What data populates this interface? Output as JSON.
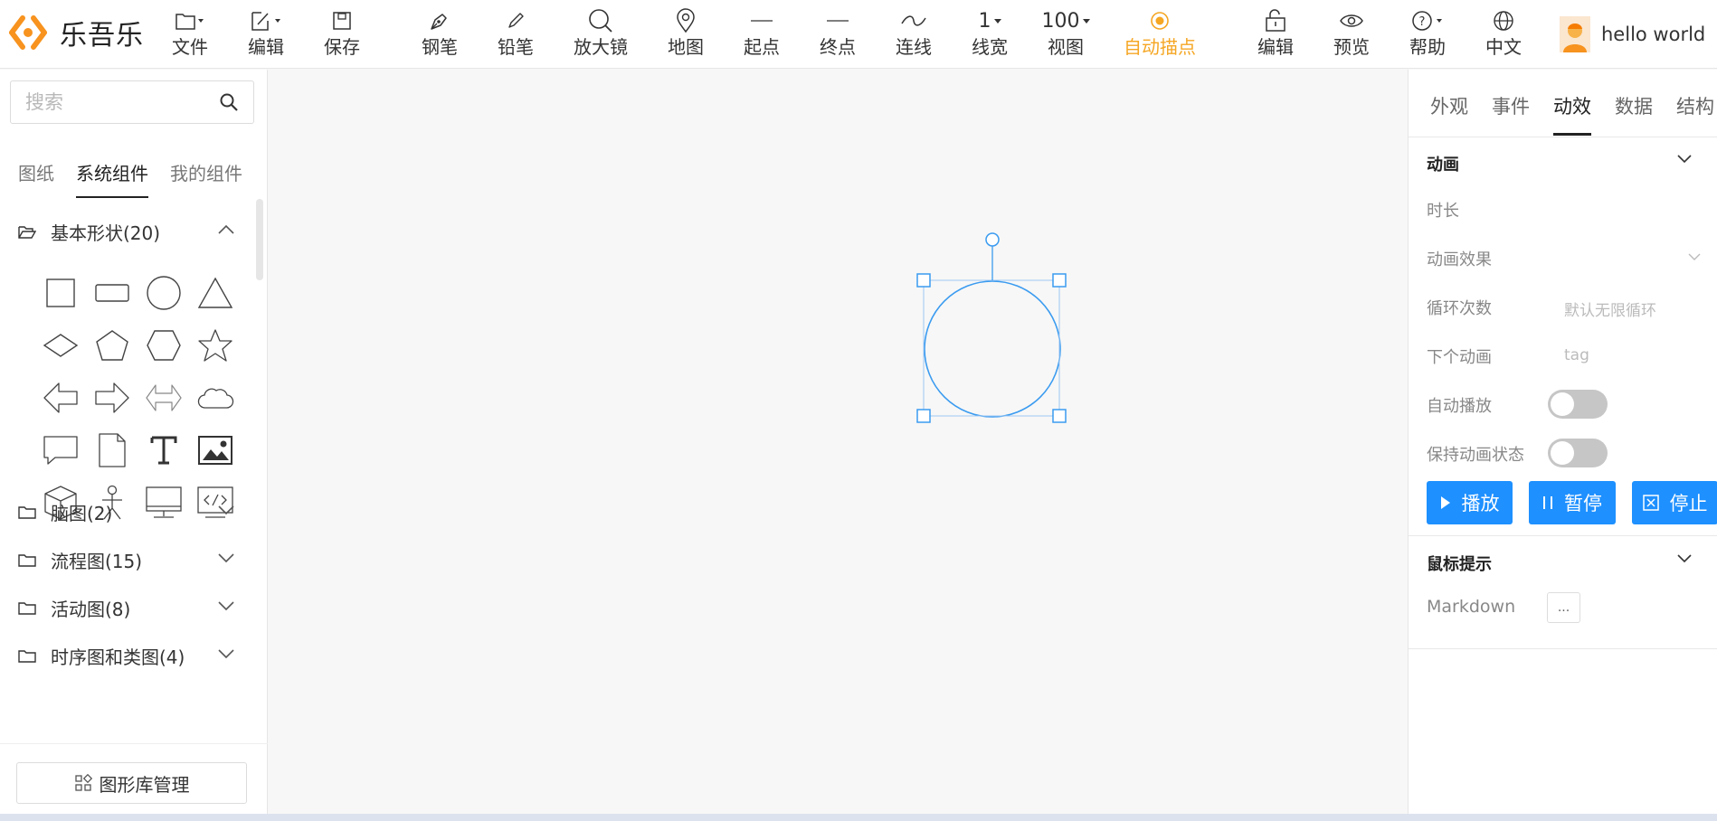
{
  "app": {
    "name": "乐吾乐"
  },
  "toolbar": {
    "file": "文件",
    "edit": "编辑",
    "save": "保存",
    "pen": "钢笔",
    "pencil": "铅笔",
    "magnifier": "放大镜",
    "map": "地图",
    "start_point": "起点",
    "end_point": "终点",
    "connect": "连线",
    "line_width_value": "1",
    "line_width": "线宽",
    "view_value": "100",
    "view": "视图",
    "auto_anchor": "自动描点",
    "edit2": "编辑",
    "preview": "预览",
    "help": "帮助",
    "language": "中文"
  },
  "user": {
    "name": "hello world"
  },
  "left_panel": {
    "search_placeholder": "搜索",
    "tabs": [
      "图纸",
      "系统组件",
      "我的组件"
    ],
    "active_tab": "系统组件",
    "groups": [
      {
        "name": "基本形状(20)",
        "expanded": true
      },
      {
        "name": "脑图(2)",
        "expanded": false
      },
      {
        "name": "流程图(15)",
        "expanded": false
      },
      {
        "name": "活动图(8)",
        "expanded": false
      },
      {
        "name": "时序图和类图(4)",
        "expanded": false
      }
    ],
    "shapes": [
      "square",
      "rectangle",
      "circle",
      "triangle",
      "diamond",
      "pentagon",
      "hexagon",
      "star",
      "left-arrow",
      "right-arrow",
      "two-way-arrow",
      "cloud",
      "message",
      "file",
      "text",
      "image",
      "cube",
      "people",
      "computer",
      "code"
    ],
    "library_button": "图形库管理"
  },
  "right_panel": {
    "tabs": [
      "外观",
      "事件",
      "动效",
      "数据",
      "结构"
    ],
    "active_tab": "动效",
    "animation": {
      "title": "动画",
      "duration_label": "时长",
      "effect_label": "动画效果",
      "loop_label": "循环次数",
      "loop_placeholder": "默认无限循环",
      "next_label": "下个动画",
      "next_placeholder": "tag",
      "autoplay_label": "自动播放",
      "autoplay": false,
      "keep_label": "保持动画状态",
      "keep": false,
      "play": "播放",
      "pause": "暂停",
      "stop": "停止"
    },
    "tooltip": {
      "title": "鼠标提示",
      "markdown_label": "Markdown",
      "more": "..."
    }
  },
  "colors": {
    "accent": "#1e90ff",
    "active_tool": "#f5a623",
    "logo": "#f7931e",
    "selection": "#3a9bf0"
  }
}
